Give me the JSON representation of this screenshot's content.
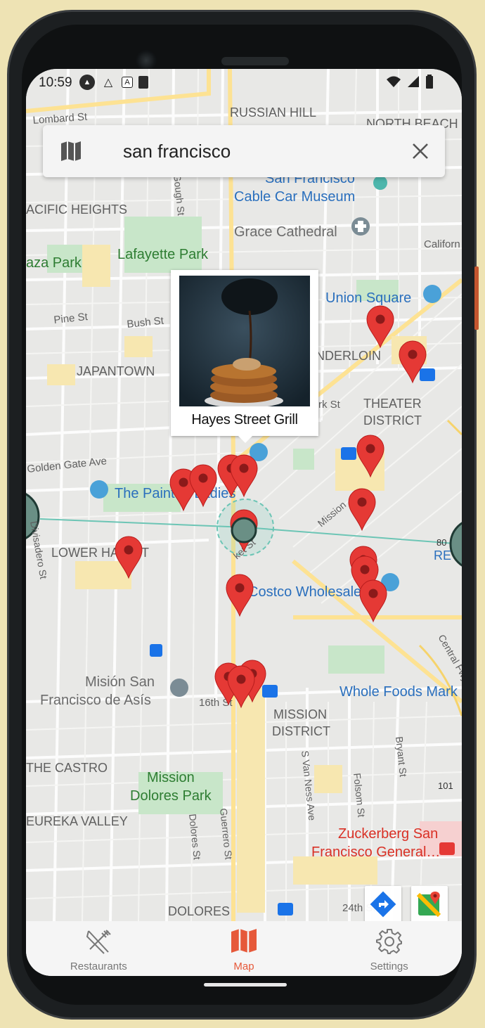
{
  "status_bar": {
    "time": "10:59"
  },
  "search": {
    "query": "san francisco",
    "map_icon": "map-icon",
    "clear_icon": "close-icon"
  },
  "callout": {
    "title": "Hayes Street Grill"
  },
  "map_labels": {
    "lombard": "Lombard St",
    "russian_hill": "RUSSIAN HILL",
    "north_beach": "NORTH BEACH",
    "cable_car_1": "San Francisco",
    "cable_car_2": "Cable Car Museum",
    "pacific_heights": "ACIFIC HEIGHTS",
    "grace": "Grace Cathedral",
    "california": "Californ",
    "plaza_park": "aza Park",
    "lafayette": "Lafayette Park",
    "union_square": "Union Square",
    "pine": "Pine St",
    "bush": "Bush St",
    "tenderloin": "NDERLOIN",
    "japantown": "JAPANTOWN",
    "eddy": "rk St",
    "theater_1": "THEATER",
    "theater_2": "DISTRICT",
    "golden_gate": "Golden Gate Ave",
    "painted_ladies": "The Painted Ladies",
    "lower_haight": "LOWER HAIGHT",
    "divisadero": "Divisadero St",
    "mission_st": "Mission",
    "market": "ket St",
    "costco": "Costco Wholesale",
    "central_fwy": "Central Fwy",
    "mision_1": "Misión San",
    "mision_2": "Francisco de Asís",
    "sixteenth": "16th St",
    "whole_foods": "Whole Foods Mark",
    "mission_district_1": "MISSION",
    "mission_district_2": "DISTRICT",
    "castro": "THE CASTRO",
    "van_ness": "S Van Ness Ave",
    "folsom": "Folsom St",
    "bryant": "Bryant St",
    "mission_dolores_1": "Mission",
    "mission_dolores_2": "Dolores Park",
    "eureka": "EUREKA VALLEY",
    "dolores_st": "Dolores St",
    "guerrero": "Guerrero St",
    "zuckerberg_1": "Zuckerberg San",
    "zuckerberg_2": "Francisco General…",
    "dolores_hood": "DOLORES",
    "twenty_fourth": "24th St",
    "gough": "Gough St",
    "hwy_101": "101",
    "hwy_80": "80",
    "re": "RE"
  },
  "nav": {
    "items": [
      {
        "label": "Restaurants",
        "icon": "utensils-icon"
      },
      {
        "label": "Map",
        "icon": "map-icon"
      },
      {
        "label": "Settings",
        "icon": "gear-icon"
      }
    ]
  },
  "colors": {
    "accent": "#e6593a",
    "pin": "#e53935",
    "pin_dark": "#8b1a1a",
    "route": "#6cc5b5"
  }
}
